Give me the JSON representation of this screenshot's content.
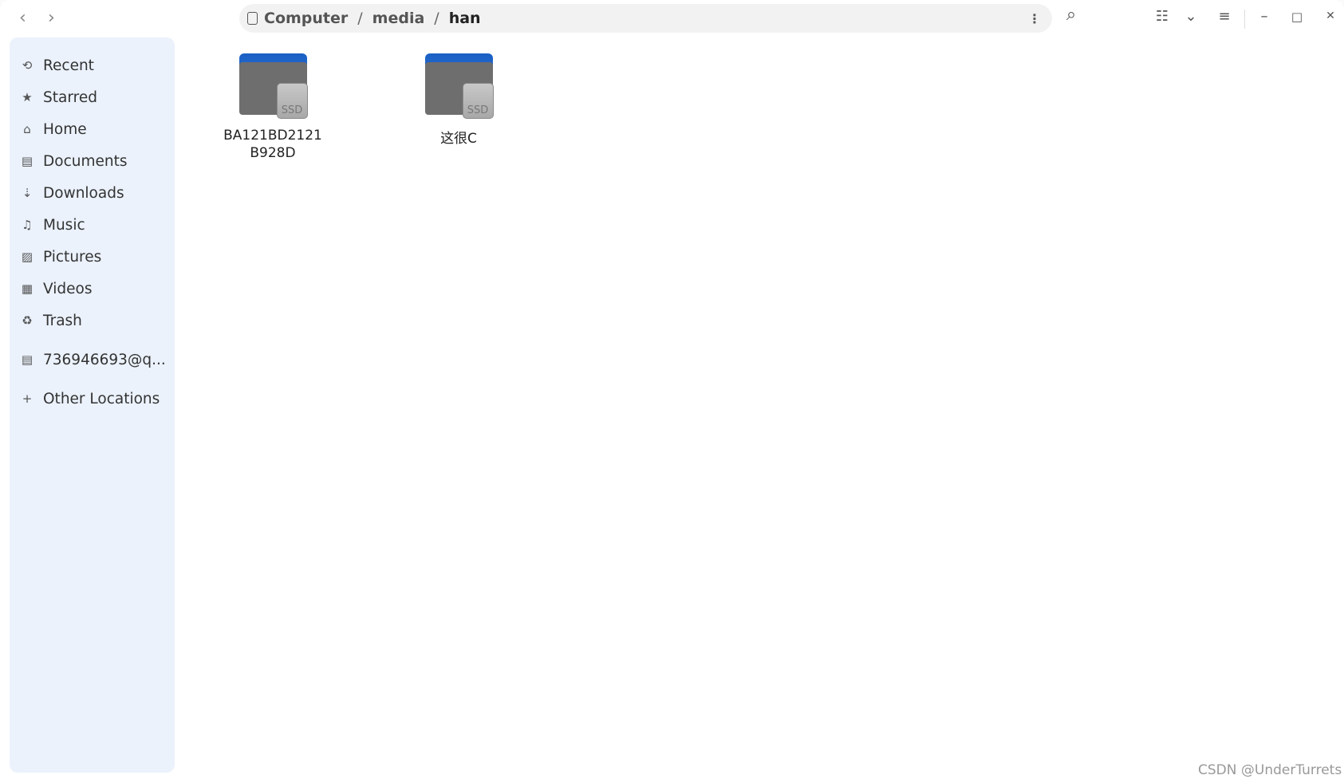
{
  "header": {
    "breadcrumb": [
      "Computer",
      "media",
      "han"
    ],
    "separator": "/",
    "icons": {
      "back": "‹",
      "forward": "›",
      "more": "⋮",
      "search": "⌕",
      "view": "☷",
      "view_options": "⌄",
      "menu": "≡",
      "minimize": "–",
      "maximize": "□",
      "close": "✕"
    }
  },
  "sidebar": {
    "items": [
      {
        "label": "Recent",
        "icon": "⟲"
      },
      {
        "label": "Starred",
        "icon": "★"
      },
      {
        "label": "Home",
        "icon": "⌂"
      },
      {
        "label": "Documents",
        "icon": "▤"
      },
      {
        "label": "Downloads",
        "icon": "⇣"
      },
      {
        "label": "Music",
        "icon": "♫"
      },
      {
        "label": "Pictures",
        "icon": "▨"
      },
      {
        "label": "Videos",
        "icon": "▦"
      },
      {
        "label": "Trash",
        "icon": "♻"
      },
      {
        "label": "736946693@q...",
        "icon": "▤"
      },
      {
        "label": "Other Locations",
        "icon": "+"
      }
    ]
  },
  "files": [
    {
      "name_line1": "BA121BD2121",
      "name_line2": "B928D",
      "badge": "SSD"
    },
    {
      "name_line1": "这很C",
      "name_line2": "",
      "badge": "SSD"
    }
  ],
  "watermark": "CSDN @UnderTurrets"
}
